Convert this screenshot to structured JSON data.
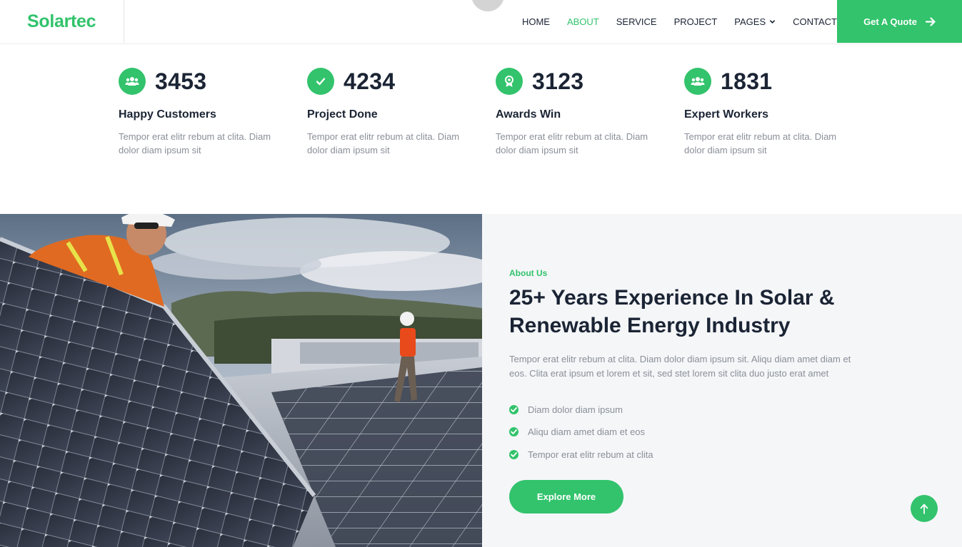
{
  "brand": {
    "name": "Solartec"
  },
  "nav": {
    "items": [
      {
        "label": "HOME",
        "active": false
      },
      {
        "label": "ABOUT",
        "active": true
      },
      {
        "label": "SERVICE",
        "active": false
      },
      {
        "label": "PROJECT",
        "active": false
      },
      {
        "label": "PAGES",
        "active": false,
        "dropdown": true
      },
      {
        "label": "CONTACT",
        "active": false
      }
    ],
    "cta_label": "Get A Quote",
    "cta_icon": "arrow-right-icon"
  },
  "facts": [
    {
      "number": "3453",
      "title": "Happy Customers",
      "text": "Tempor erat elitr rebum at clita. Diam dolor diam ipsum sit",
      "icon": "users-icon"
    },
    {
      "number": "4234",
      "title": "Project Done",
      "text": "Tempor erat elitr rebum at clita. Diam dolor diam ipsum sit",
      "icon": "check-icon"
    },
    {
      "number": "3123",
      "title": "Awards Win",
      "text": "Tempor erat elitr rebum at clita. Diam dolor diam ipsum sit",
      "icon": "award-icon"
    },
    {
      "number": "1831",
      "title": "Expert Workers",
      "text": "Tempor erat elitr rebum at clita. Diam dolor diam ipsum sit",
      "icon": "users-icon"
    }
  ],
  "about": {
    "label": "About Us",
    "title": "25+ Years Experience In Solar & Renewable Energy Industry",
    "text": "Tempor erat elitr rebum at clita. Diam dolor diam ipsum sit. Aliqu diam amet diam et eos. Clita erat ipsum et lorem et sit, sed stet lorem sit clita duo justo erat amet",
    "checklist": [
      "Diam dolor diam ipsum",
      "Aliqu diam amet diam et eos",
      "Tempor erat elitr rebum at clita"
    ],
    "button_label": "Explore More",
    "image_alt": "Workers installing solar panels"
  },
  "colors": {
    "accent": "#32c36c",
    "heading": "#1b2434",
    "muted": "#8a8f98",
    "section_bg": "#f4f6f8"
  }
}
